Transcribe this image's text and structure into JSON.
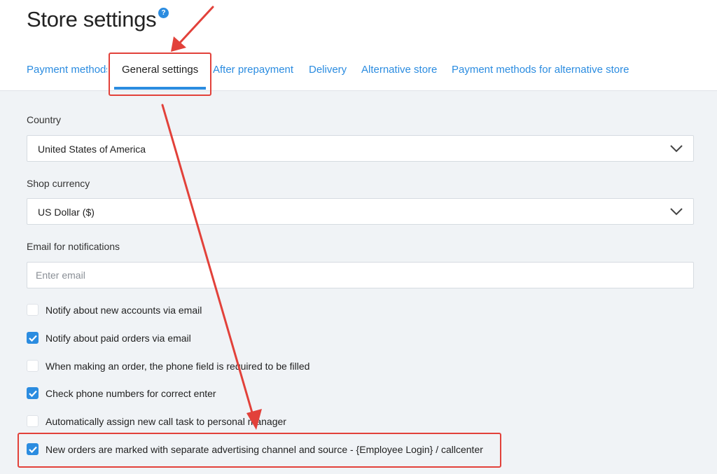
{
  "page": {
    "title": "Store settings",
    "help_glyph": "?"
  },
  "tabs": [
    {
      "label": "Payment methods",
      "active": false
    },
    {
      "label": "General settings",
      "active": true
    },
    {
      "label": "After prepayment",
      "active": false
    },
    {
      "label": "Delivery",
      "active": false
    },
    {
      "label": "Alternative store",
      "active": false
    },
    {
      "label": "Payment methods for alternative store",
      "active": false
    }
  ],
  "form": {
    "country": {
      "label": "Country",
      "value": "United States of America"
    },
    "currency": {
      "label": "Shop currency",
      "value": "US Dollar ($)"
    },
    "email": {
      "label": "Email for notifications",
      "value": "",
      "placeholder": "Enter email"
    }
  },
  "checkboxes": [
    {
      "label": "Notify about new accounts via email",
      "checked": false
    },
    {
      "label": "Notify about paid orders via email",
      "checked": true
    },
    {
      "label": "When making an order, the phone field is required to be filled",
      "checked": false
    },
    {
      "label": "Check phone numbers for correct enter",
      "checked": true
    },
    {
      "label": "Automatically assign new call task to personal manager",
      "checked": false
    },
    {
      "label": "New orders are marked with separate advertising channel and source - {Employee Login} / callcenter",
      "checked": true
    }
  ],
  "colors": {
    "accent": "#2b8ce0",
    "annotation": "#e2413a",
    "background": "#f0f3f6"
  }
}
